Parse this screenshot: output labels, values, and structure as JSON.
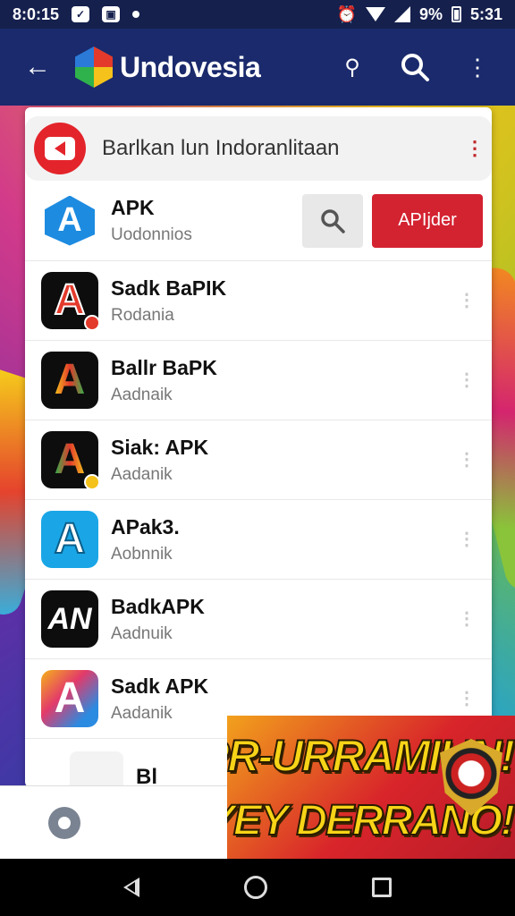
{
  "status_bar": {
    "time": "8:0:15",
    "battery": "9%",
    "clock_right": "5:31"
  },
  "app_bar": {
    "title": "Undovesia"
  },
  "banner": {
    "text": "Barlkan lun Indoranlitaan"
  },
  "top_app": {
    "name": "APK",
    "subtitle": "Uodonnios",
    "apply_label": "APIjder"
  },
  "apps": [
    {
      "name": "Sadk BaPIK",
      "subtitle": "Rodania",
      "icon": "a-dark-icon",
      "badge_color": "#e33a2c"
    },
    {
      "name": "Ballr BaPK",
      "subtitle": "Aadnaik",
      "icon": "a-dark-icon",
      "badge_color": ""
    },
    {
      "name": "Siak: APK",
      "subtitle": "Aadanik",
      "icon": "a-dark-icon",
      "badge_color": "#f4c21b"
    },
    {
      "name": "APak3.",
      "subtitle": "Aobnnik",
      "icon": "a-sky-icon",
      "badge_color": ""
    },
    {
      "name": "BadkAPK",
      "subtitle": "Aadnuik",
      "icon": "an-dark-icon",
      "badge_color": ""
    },
    {
      "name": "Sadk APK",
      "subtitle": "Aadanik",
      "icon": "a-rainbow-icon",
      "badge_color": ""
    }
  ],
  "partial_row": {
    "name": "Bl"
  },
  "promo": {
    "line1": "MPR-URRAMIUN!",
    "line2": "SPYEY DERRANO!"
  },
  "colors": {
    "app_bar": "#1a2a6c",
    "accent_red": "#d32230",
    "promo_yellow": "#f7d417"
  }
}
